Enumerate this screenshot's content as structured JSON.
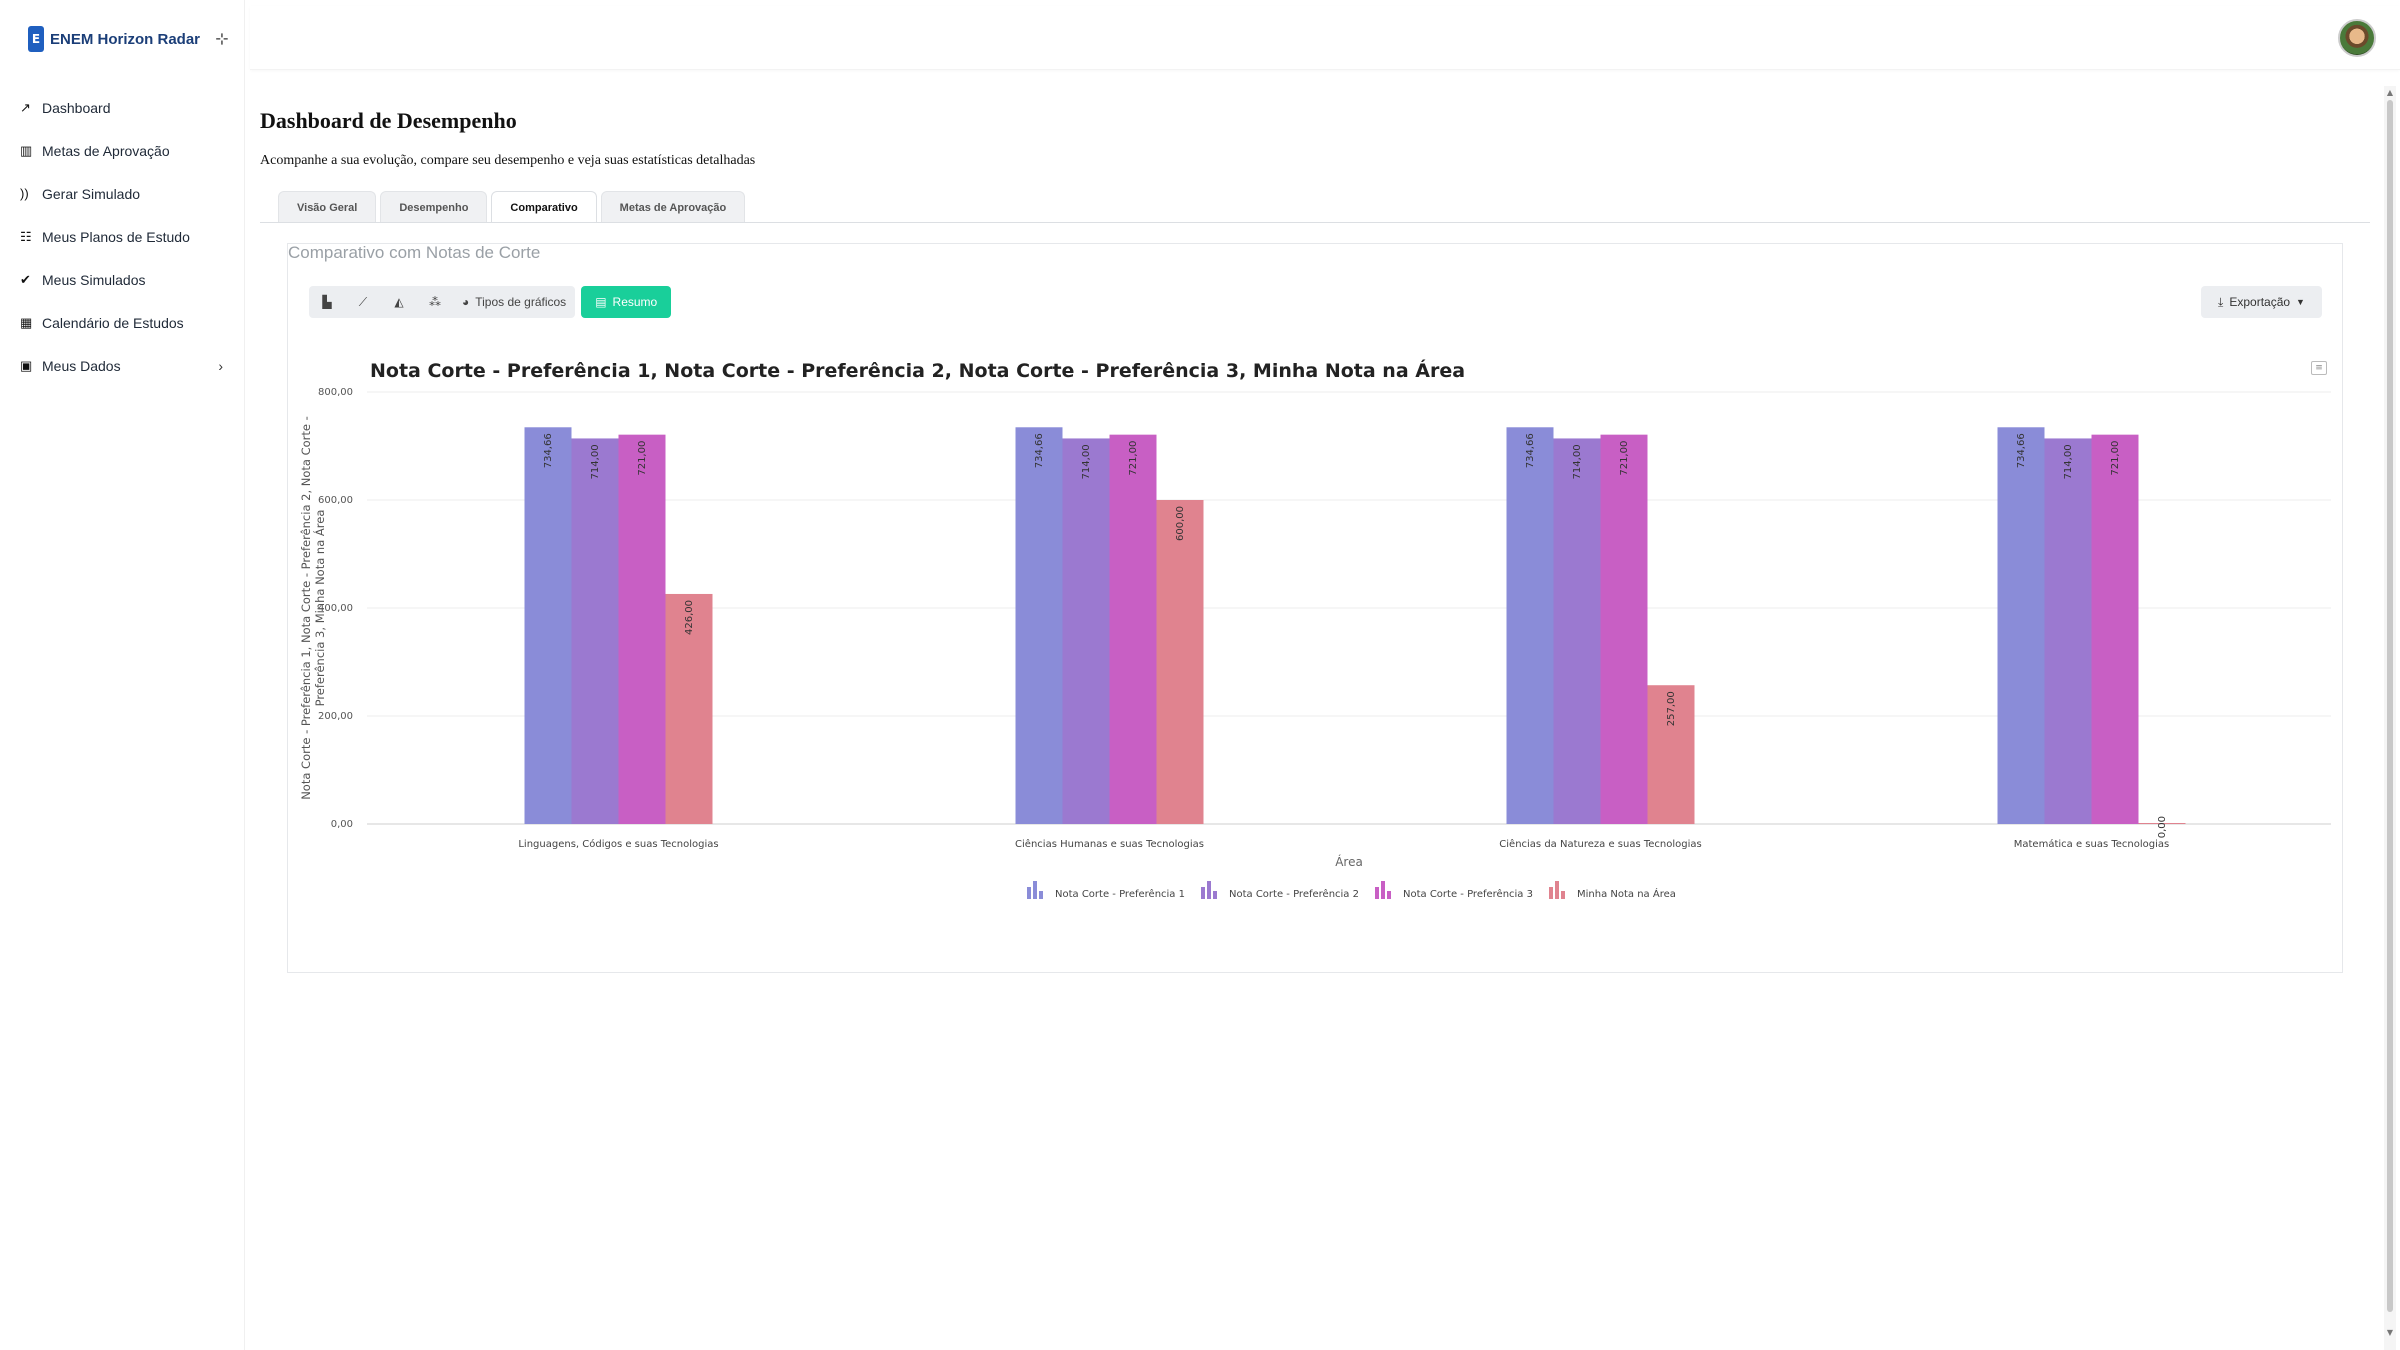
{
  "brand": {
    "logo_letter": "E",
    "name": "ENEM Horizon Radar"
  },
  "sidebar": {
    "items": [
      {
        "label": "Dashboard",
        "icon": "chart-line-icon",
        "glyph": "↗"
      },
      {
        "label": "Metas de Aprovação",
        "icon": "chart-bar-icon",
        "glyph": "▥"
      },
      {
        "label": "Gerar Simulado",
        "icon": "rss-icon",
        "glyph": "))"
      },
      {
        "label": "Meus Planos de Estudo",
        "icon": "list-chart-icon",
        "glyph": "☷"
      },
      {
        "label": "Meus Simulados",
        "icon": "check-double-icon",
        "glyph": "✔"
      },
      {
        "label": "Calendário de Estudos",
        "icon": "calendar-icon",
        "glyph": "▦"
      },
      {
        "label": "Meus Dados",
        "icon": "id-card-icon",
        "glyph": "▣",
        "chevron": "›"
      }
    ]
  },
  "page": {
    "title": "Dashboard de Desempenho",
    "subtitle": "Acompanhe a sua evolução, compare seu desempenho e veja suas estatísticas detalhadas"
  },
  "tabs": [
    {
      "label": "Visão Geral",
      "active": false
    },
    {
      "label": "Desempenho",
      "active": false
    },
    {
      "label": "Comparativo",
      "active": true
    },
    {
      "label": "Metas de Aprovação",
      "active": false
    }
  ],
  "card": {
    "title": "Comparativo com Notas de Corte"
  },
  "toolbar": {
    "chart_types_label": "Tipos de gráficos",
    "summary_label": "Resumo",
    "export_label": "Exportação"
  },
  "chart_data": {
    "type": "bar",
    "title": "Nota Corte - Preferência 1, Nota Corte - Preferência 2, Nota Corte - Preferência 3, Minha Nota na Área",
    "xlabel": "Área",
    "ylabel": "Nota Corte - Preferência 1, Nota Corte - Preferência 2, Nota Corte - Preferência 3, Minha Nota na Área",
    "ylim": [
      0,
      800
    ],
    "yticks": [
      0,
      200,
      400,
      600,
      800
    ],
    "ytick_labels": [
      "0,00",
      "200,00",
      "400,00",
      "600,00",
      "800,00"
    ],
    "legend_position": "bottom",
    "grid": true,
    "categories": [
      "Linguagens, Códigos e suas Tecnologias",
      "Ciências Humanas e suas Tecnologias",
      "Ciências da Natureza e suas Tecnologias",
      "Matemática e suas Tecnologias"
    ],
    "series": [
      {
        "name": "Nota Corte - Preferência 1",
        "color": "#8a8cd8",
        "values": [
          734.66,
          734.66,
          734.66,
          734.66
        ],
        "labels": [
          "734,66",
          "734,66",
          "734,66",
          "734,66"
        ]
      },
      {
        "name": "Nota Corte - Preferência 2",
        "color": "#9b79d0",
        "values": [
          714.0,
          714.0,
          714.0,
          714.0
        ],
        "labels": [
          "714,00",
          "714,00",
          "714,00",
          "714,00"
        ]
      },
      {
        "name": "Nota Corte - Preferência 3",
        "color": "#c85fc4",
        "values": [
          721.0,
          721.0,
          721.0,
          721.0
        ],
        "labels": [
          "721,00",
          "721,00",
          "721,00",
          "721,00"
        ]
      },
      {
        "name": "Minha Nota na Área",
        "color": "#e0838f",
        "values": [
          426.0,
          600.0,
          257.0,
          0.0
        ],
        "labels": [
          "426,00",
          "600,00",
          "257,00",
          "0,00"
        ]
      }
    ]
  }
}
